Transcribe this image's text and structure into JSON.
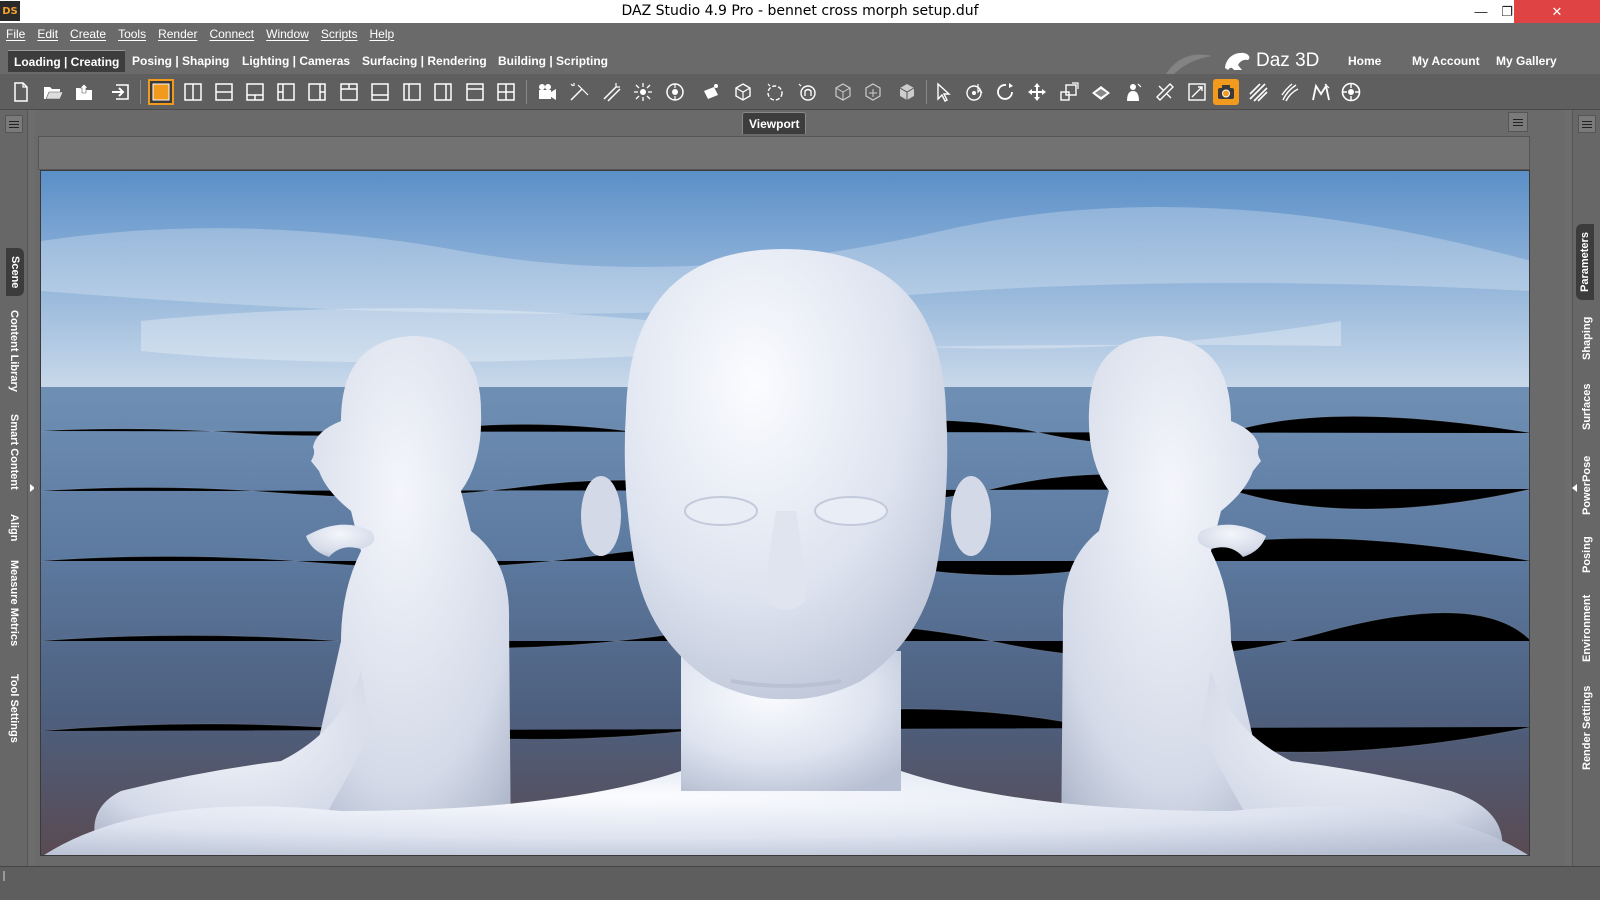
{
  "window": {
    "title": "DAZ Studio 4.9 Pro - bennet cross morph setup.duf",
    "logo_text": "DS",
    "minimize_glyph": "—",
    "restore_glyph": "❐",
    "close_glyph": "✕"
  },
  "menu": [
    "File",
    "Edit",
    "Create",
    "Tools",
    "Render",
    "Connect",
    "Window",
    "Scripts",
    "Help"
  ],
  "layout_tabs": [
    {
      "label": "Loading | Creating",
      "active": true
    },
    {
      "label": "Posing | Shaping",
      "active": false
    },
    {
      "label": "Lighting | Cameras",
      "active": false
    },
    {
      "label": "Surfacing | Rendering",
      "active": false
    },
    {
      "label": "Building | Scripting",
      "active": false
    }
  ],
  "brand": {
    "name": "Daz 3D"
  },
  "nav_links": [
    "Home",
    "My Account",
    "My Gallery"
  ],
  "toolbar_icons": [
    "new-scene-icon",
    "open-icon",
    "merge-icon",
    "import-icon",
    "layout-1-icon",
    "layout-2v-icon",
    "layout-2h-icon",
    "layout-3a-icon",
    "layout-3b-icon",
    "layout-3c-icon",
    "layout-3d-icon",
    "layout-3e-icon",
    "layout-3f-icon",
    "layout-3g-icon",
    "layout-3h-icon",
    "layout-4-icon",
    "create-camera-icon",
    "create-spotlight-icon",
    "create-distant-light-icon",
    "create-point-light-icon",
    "create-linear-light-icon",
    "create-primitive-icon",
    "create-null-icon",
    "create-group-icon",
    "create-rigid-follow-icon",
    "bone-tool-icon",
    "joint-editor-icon",
    "geometry-editor-icon",
    "node-selection-icon",
    "universal-tool-icon",
    "rotate-tool-icon",
    "translate-tool-icon",
    "scale-tool-icon",
    "surface-selection-icon",
    "active-pose-icon",
    "power-pose-icon",
    "region-navigator-icon",
    "render-icon",
    "spot-render-icon",
    "hair-tool-icon",
    "transfer-utility-icon",
    "morph-loader-icon",
    "dforce-icon"
  ],
  "left_tabs": [
    "Scene",
    "Content Library",
    "Smart Content",
    "Align",
    "Measure Metrics",
    "Tool Settings"
  ],
  "right_tabs": [
    "Parameters",
    "Shaping",
    "Surfaces",
    "PowerPose",
    "Posing",
    "Environment",
    "Render Settings"
  ],
  "viewport": {
    "tab_label": "Viewport"
  },
  "colors": {
    "accent": "#f29a1d",
    "chrome": "#6a6a6a",
    "close": "#e04343"
  }
}
